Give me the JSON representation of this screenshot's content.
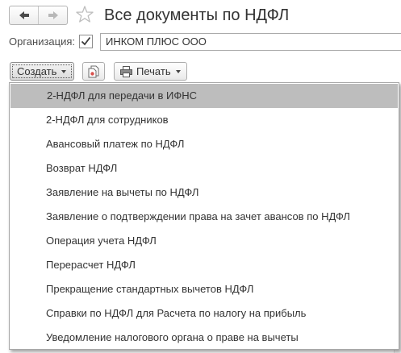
{
  "header": {
    "title": "Все документы по НДФЛ",
    "back_icon": "arrow-left-icon",
    "forward_icon": "arrow-right-icon",
    "favorite_icon": "star-icon"
  },
  "filter": {
    "organization_label": "Организация:",
    "organization_checked": true,
    "organization_value": "ИНКОМ ПЛЮС ООО"
  },
  "toolbar": {
    "create_label": "Создать",
    "copy_icon": "copy-document-icon",
    "print_icon": "printer-icon",
    "print_label": "Печать"
  },
  "create_menu": {
    "items": [
      {
        "label": "2-НДФЛ для передачи в ИФНС",
        "active": true
      },
      {
        "label": "2-НДФЛ для сотрудников"
      },
      {
        "label": "Авансовый платеж по НДФЛ"
      },
      {
        "label": "Возврат НДФЛ"
      },
      {
        "label": "Заявление на вычеты по НДФЛ"
      },
      {
        "label": "Заявление о подтверждении права на зачет авансов по НДФЛ"
      },
      {
        "label": "Операция учета НДФЛ"
      },
      {
        "label": "Перерасчет НДФЛ"
      },
      {
        "label": "Прекращение стандартных вычетов НДФЛ"
      },
      {
        "label": "Справки по НДФЛ для Расчета по налогу на прибыль"
      },
      {
        "label": "Уведомление налогового органа о праве на вычеты"
      }
    ]
  },
  "colors": {
    "active_item_bg": "#bdbdbd",
    "text": "#333333",
    "border": "#a8a8a8"
  }
}
